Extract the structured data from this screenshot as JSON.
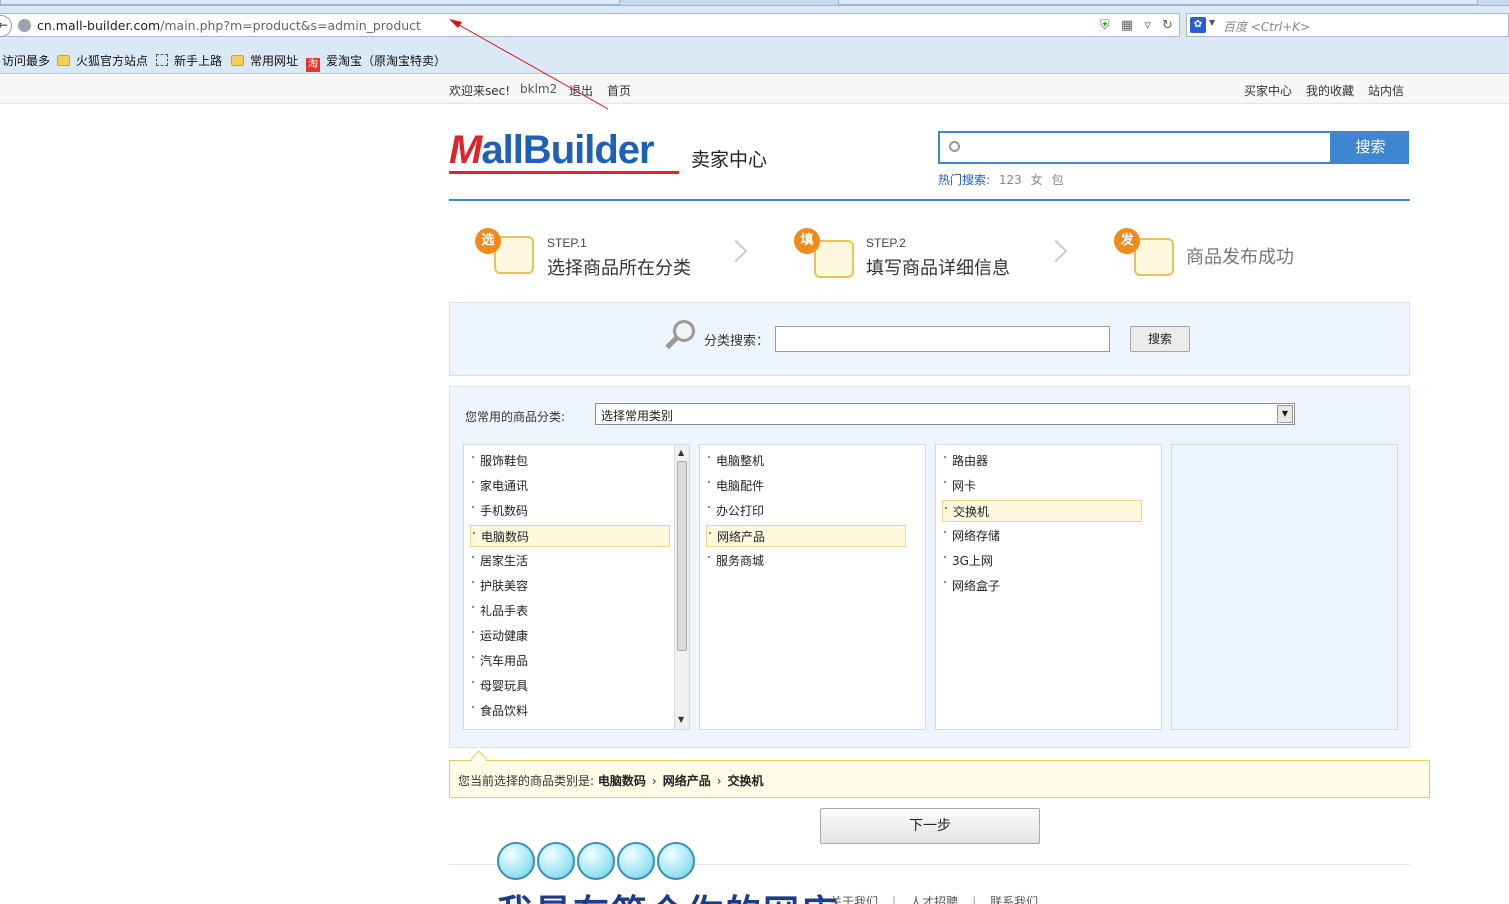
{
  "browser": {
    "url_domain": "cn.mall-builder.com",
    "url_path": "/main.php?m=product&s=admin_product",
    "search_placeholder": "百度 <Ctrl+K>"
  },
  "bookmarks": [
    {
      "label": "访问最多",
      "icon": "none"
    },
    {
      "label": "火狐官方站点",
      "icon": "folder-icon"
    },
    {
      "label": "新手上路",
      "icon": "dashed-box-icon"
    },
    {
      "label": "常用网址",
      "icon": "folder-icon"
    },
    {
      "label": "爱淘宝（原淘宝特卖）",
      "icon": "taobao-icon"
    }
  ],
  "topbar": {
    "welcome": "欢迎来sec!",
    "username": "bklm2",
    "logout": "退出",
    "home": "首页",
    "buyer_center": "买家中心",
    "favorites": "我的收藏",
    "messages": "站内信"
  },
  "header": {
    "logo_m": "M",
    "logo_rest": "allBuilder",
    "seller_center": "卖家中心",
    "search_button": "搜索",
    "hot_label": "热门搜索:",
    "hot_keywords": [
      "123",
      "女",
      "包"
    ],
    "accent_color": "#3f86d1",
    "brand_red": "#d8262e"
  },
  "steps": [
    {
      "badge": "选",
      "num": "STEP.1",
      "title": "选择商品所在分类"
    },
    {
      "badge": "填",
      "num": "STEP.2",
      "title": "填写商品详细信息"
    },
    {
      "badge": "发",
      "num": "",
      "title": "商品发布成功"
    }
  ],
  "category_search": {
    "label": "分类搜索：",
    "button": "搜索"
  },
  "common_categories": {
    "label": "您常用的商品分类:",
    "selected": "选择常用类别"
  },
  "columns": {
    "col1": [
      "服饰鞋包",
      "家电通讯",
      "手机数码",
      "电脑数码",
      "居家生活",
      "护肤美容",
      "礼品手表",
      "运动健康",
      "汽车用品",
      "母婴玩具",
      "食品饮料"
    ],
    "col1_selected": "电脑数码",
    "col2": [
      "电脑整机",
      "电脑配件",
      "办公打印",
      "网络产品",
      "服务商城"
    ],
    "col2_selected": "网络产品",
    "col3": [
      "路由器",
      "网卡",
      "交换机",
      "网络存储",
      "3G上网",
      "网络盒子"
    ],
    "col3_selected": "交换机"
  },
  "current_selection": {
    "label": "您当前选择的商品类别是:",
    "path": [
      "电脑数码",
      "网络产品",
      "交换机"
    ]
  },
  "next_button": "下一步",
  "footer": {
    "links": [
      "关于我们",
      "人才招聘",
      "联系我们"
    ]
  },
  "overlay_text": "我是在简介你的网店"
}
